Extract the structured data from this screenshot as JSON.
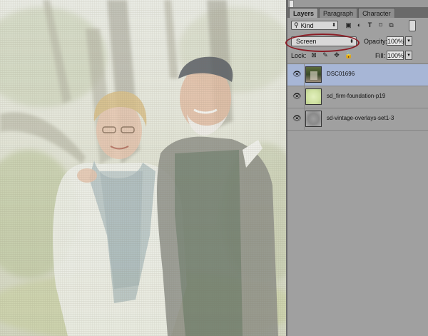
{
  "panel": {
    "tabs": [
      {
        "label": "Layers",
        "active": true
      },
      {
        "label": "Paragraph",
        "active": false
      },
      {
        "label": "Character",
        "active": false
      }
    ],
    "filter": {
      "kind_label": "Kind",
      "icons": [
        "pixel-filter-icon",
        "adjustment-filter-icon",
        "type-filter-icon",
        "shape-filter-icon",
        "smart-object-filter-icon"
      ]
    },
    "blend": {
      "mode": "Screen",
      "opacity_label": "Opacity:",
      "opacity_value": "100%"
    },
    "lock": {
      "label": "Lock:",
      "fill_label": "Fill:",
      "fill_value": "100%"
    },
    "layers": [
      {
        "name": "DSC01696",
        "visible": true,
        "selected": true
      },
      {
        "name": "sd_firm-foundation-p19",
        "visible": true,
        "selected": false
      },
      {
        "name": "sd-vintage-overlays-set1-3",
        "visible": true,
        "selected": false
      }
    ]
  },
  "colors": {
    "panel_bg": "#a0a0a0",
    "selected_layer": "#a7b6d6",
    "highlight_oval": "#8c1c25"
  }
}
